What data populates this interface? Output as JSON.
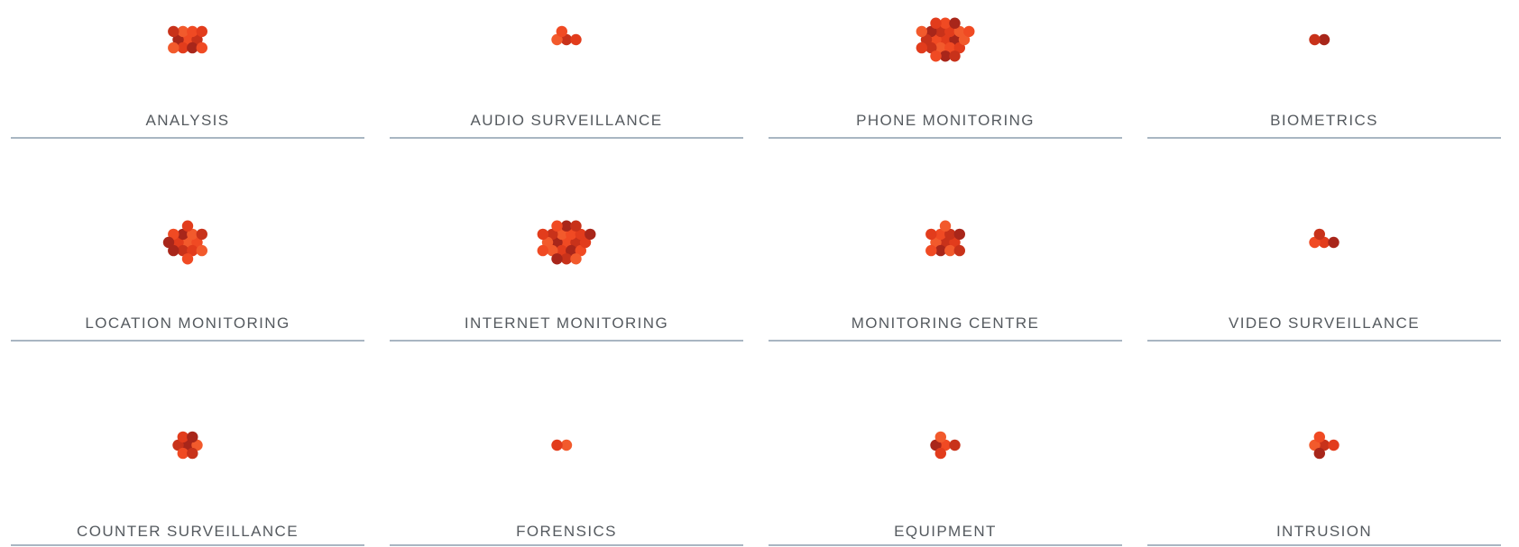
{
  "colors": {
    "dot_palette": [
      "#f04a23",
      "#c8321a",
      "#e23c1c",
      "#a8261a",
      "#f25a2c"
    ],
    "label_text": "#555a5f",
    "rule": "#a9b6c2",
    "background": "#ffffff"
  },
  "categories": [
    {
      "label": "ANALYSIS",
      "count": 11
    },
    {
      "label": "AUDIO SURVEILLANCE",
      "count": 4
    },
    {
      "label": "PHONE MONITORING",
      "count": 22
    },
    {
      "label": "BIOMETRICS",
      "count": 2
    },
    {
      "label": "LOCATION MONITORING",
      "count": 14
    },
    {
      "label": "INTERNET MONITORING",
      "count": 22
    },
    {
      "label": "MONITORING CENTRE",
      "count": 12
    },
    {
      "label": "VIDEO SURVEILLANCE",
      "count": 4
    },
    {
      "label": "COUNTER SURVEILLANCE",
      "count": 7
    },
    {
      "label": "FORENSICS",
      "count": 2
    },
    {
      "label": "EQUIPMENT",
      "count": 5
    },
    {
      "label": "INTRUSION",
      "count": 5
    }
  ]
}
